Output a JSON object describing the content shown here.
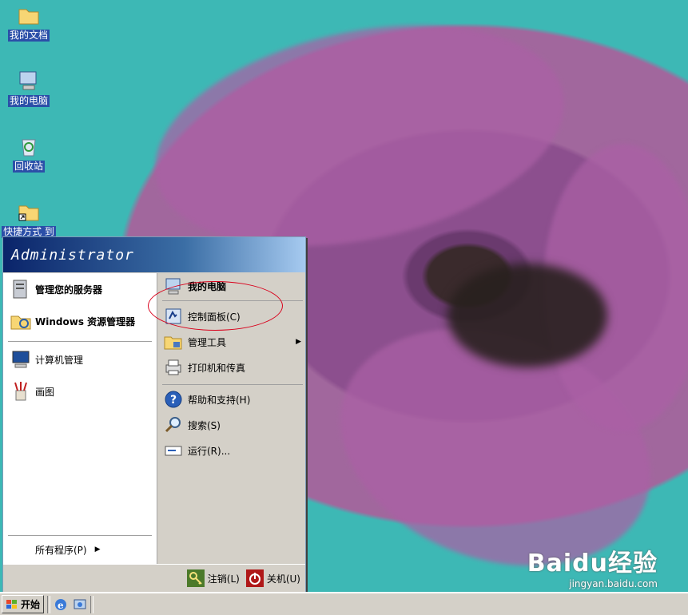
{
  "desktop": {
    "icons": [
      {
        "label": "我的文档"
      },
      {
        "label": "我的电脑"
      },
      {
        "label": "回收站"
      },
      {
        "label": "快捷方式 到"
      }
    ]
  },
  "start_menu": {
    "user": "Administrator",
    "left_items": [
      {
        "label": "管理您的服务器"
      },
      {
        "label": "Windows 资源管理器"
      },
      {
        "label": "计算机管理"
      },
      {
        "label": "画图"
      }
    ],
    "all_programs": "所有程序(P)",
    "right_items": [
      {
        "label": "我的电脑"
      },
      {
        "label": "控制面板(C)"
      },
      {
        "label": "管理工具"
      },
      {
        "label": "打印机和传真"
      },
      {
        "label": "帮助和支持(H)"
      },
      {
        "label": "搜索(S)"
      },
      {
        "label": "运行(R)..."
      }
    ],
    "logoff": "注销(L)",
    "shutdown": "关机(U)"
  },
  "taskbar": {
    "start_label": "开始"
  },
  "watermark": {
    "brand": "Baidu经验",
    "url": "jingyan.baidu.com"
  },
  "colors": {
    "highlight_circle": "#d9001b",
    "menu_header": "#0a246a"
  }
}
